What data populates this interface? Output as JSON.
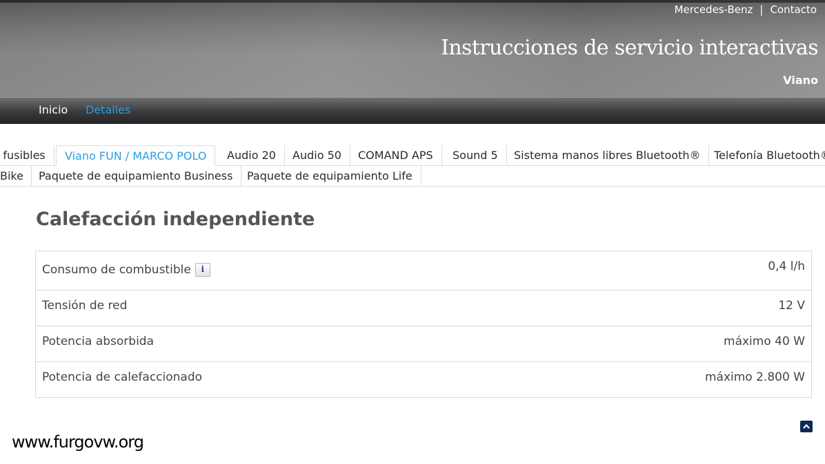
{
  "header": {
    "links": [
      "Mercedes-Benz",
      "Contacto"
    ],
    "separator": "|",
    "title": "Instrucciones de servicio interactivas",
    "model": "Viano"
  },
  "nav": {
    "items": [
      "Inicio",
      "Detalles"
    ],
    "active": "Detalles",
    "active_color": "#2a9fe0"
  },
  "tabs": {
    "row1": [
      "s fusibles",
      "Viano FUN / MARCO POLO",
      "Audio 20",
      "Audio 50",
      "COMAND APS",
      "Sound 5",
      "Sistema manos libres Bluetooth®",
      "Telefonía Bluetooth®"
    ],
    "row2": [
      "Bike",
      "Paquete de equipamiento Business",
      "Paquete de equipamiento Life"
    ],
    "active": "Viano FUN / MARCO POLO"
  },
  "main": {
    "title": "Calefacción independiente",
    "specs": [
      {
        "label": "Consumo de combustible",
        "value": "0,4 l/h",
        "info": "i"
      },
      {
        "label": "Tensión de red",
        "value": "12 V"
      },
      {
        "label": "Potencia absorbida",
        "value": "máximo 40 W"
      },
      {
        "label": "Potencia de calefaccionado",
        "value": "máximo 2.800 W"
      }
    ]
  },
  "back_to_top_icon": "chevron-up-icon",
  "watermark": "www.furgovw.org"
}
